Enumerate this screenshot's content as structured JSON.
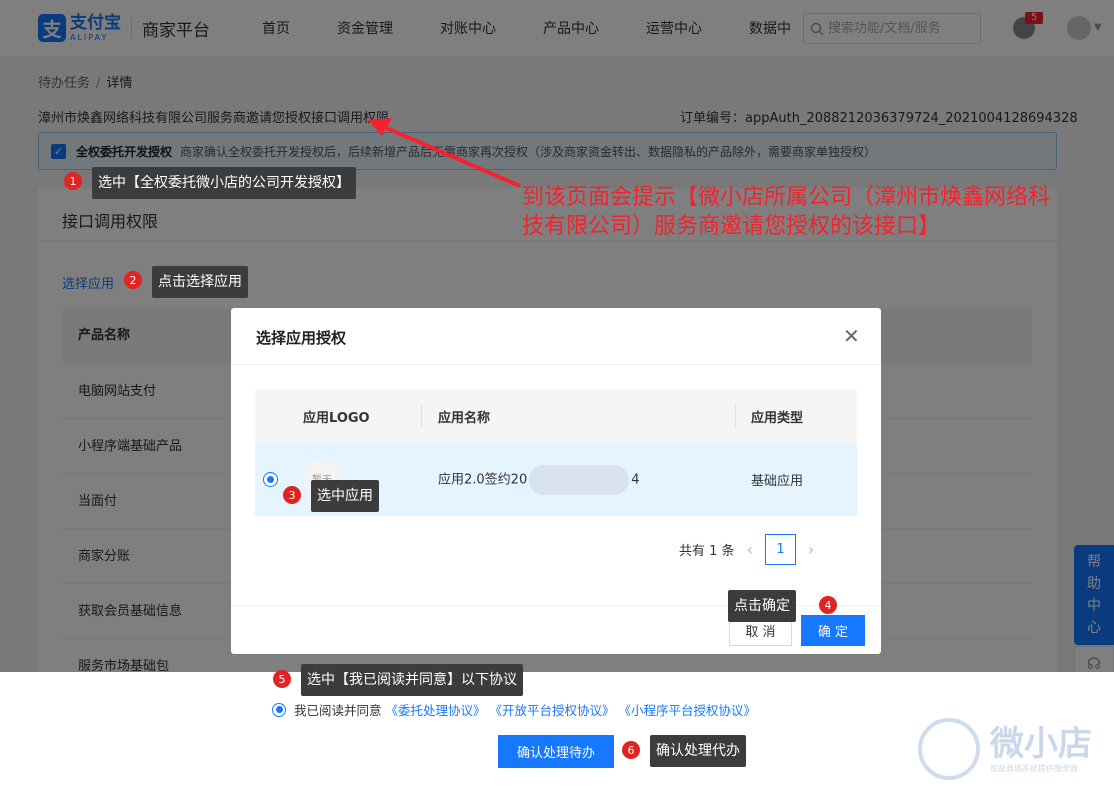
{
  "header": {
    "logo_cn": "支付宝",
    "logo_en": "ALIPAY",
    "platform": "商家平台",
    "nav": [
      "首页",
      "资金管理",
      "对账中心",
      "产品中心",
      "运营中心",
      "数据中"
    ],
    "search_placeholder": "搜索功能/文档/服务",
    "notification_count": "5"
  },
  "breadcrumb": {
    "parent": "待办任务",
    "separator": "/",
    "current": "详情"
  },
  "page_title": "漳州市焕鑫网络科技有限公司服务商邀请您授权接口调用权限",
  "order_no": "订单编号：appAuth_2088212036379724_2021004128694328",
  "alert": {
    "strong": "全权委托开发授权",
    "text": "商家确认全权委托开发授权后，后续新增产品后无需商家再次授权（涉及商家资金转出、数据隐私的产品除外，需要商家单独授权）"
  },
  "card": {
    "title": "接口调用权限",
    "select_app": "选择应用",
    "table_header": "产品名称",
    "products": [
      "电脑网站支付",
      "小程序端基础产品",
      "当面付",
      "商家分账",
      "获取会员基础信息",
      "服务市场基础包"
    ]
  },
  "agreement": {
    "prefix": "我已阅读并同意",
    "links": [
      "《委托处理协议》",
      "《开放平台授权协议》",
      "《小程序平台授权协议》"
    ]
  },
  "submit_label": "确认处理待办",
  "help": {
    "chars": [
      "帮",
      "助",
      "中",
      "心"
    ]
  },
  "modal": {
    "title": "选择应用授权",
    "columns": [
      "应用LOGO",
      "应用名称",
      "应用类型"
    ],
    "row": {
      "logo_text": "暂无",
      "name_prefix": "应用2.0签约20",
      "name_suffix": "4",
      "type": "基础应用"
    },
    "pager": {
      "total": "共有 1 条",
      "page": "1"
    },
    "cancel": "取 消",
    "ok": "确 定"
  },
  "annotations": [
    {
      "num": "1",
      "text": "选中【全权委托微小店的公司开发授权】"
    },
    {
      "num": "2",
      "text": "点击选择应用"
    },
    {
      "num": "3",
      "text": "选中应用"
    },
    {
      "num": "4",
      "text": "点击确定"
    },
    {
      "num": "5",
      "text": "选中【我已阅读并同意】以下协议"
    },
    {
      "num": "6",
      "text": "确认处理代办"
    }
  ],
  "red_note": "到该页面会提示【微小店所属公司（漳州市焕鑫网络科技有限公司）服务商邀请您授权的该接口】",
  "watermark": {
    "name": "微小店",
    "sub": "权益商城系统提供服务商"
  },
  "colors": {
    "primary": "#1677ff",
    "annotation_red": "#e02424",
    "note_red": "#f5222d"
  }
}
